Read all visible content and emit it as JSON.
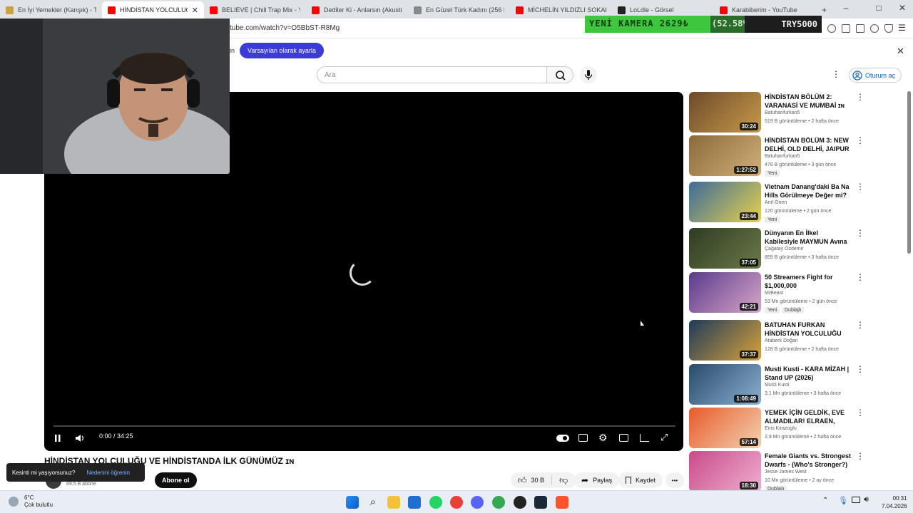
{
  "tabs": [
    {
      "label": "En İyi Yemekler (Karışık) - Tier L",
      "favicon": "#c8a046"
    },
    {
      "label": "HİNDİSTAN YOLCULUĞU V",
      "favicon": "#ff0000",
      "active": true
    },
    {
      "label": "BELIEVE | Chill Trap Mix - YouTu",
      "favicon": "#ff0000"
    },
    {
      "label": "Dediler Ki - Anlarsın (Akustik V",
      "favicon": "#ff0000"
    },
    {
      "label": "En Güzel Türk Kadını (256 Kişi)",
      "favicon": "#888888"
    },
    {
      "label": "MİCHELİN YILDIZLI SOKAK LEZ",
      "favicon": "#ff0000"
    },
    {
      "label": "LoLdle - Görsel",
      "favicon": "#222222"
    },
    {
      "label": "Karabiberim - YouTube",
      "favicon": "#ff0000"
    }
  ],
  "new_tab_icon": "plus-icon",
  "window_controls": {
    "minimize": "–",
    "maximize": "□",
    "close": "✕"
  },
  "url": "tube.com/watch?v=O5BbST-R8Mg",
  "stream_overlay": {
    "left": "YENİ KAMERA  2629₺",
    "middle": "(52.58%)",
    "right": "TRY5000"
  },
  "consent": {
    "left_text": "in",
    "button": "Varsayılan olarak ayarla"
  },
  "search": {
    "placeholder": "Ara"
  },
  "signin": "Oturum aç",
  "player": {
    "time": "0:00 / 34:25"
  },
  "video": {
    "title": "HİNDİSTAN YOLCULUĞU VE HİNDİSTANDA İLK GÜNÜMÜZ ɪɴ",
    "subscribers": "69,5 B abone",
    "subscribe": "Abone ol",
    "likes": "30 B",
    "share": "Paylaş",
    "save": "Kaydet",
    "more": "•••"
  },
  "toast": {
    "text": "Kesinti mi yaşıyorsunuz?",
    "link": "Nedenini öğrenin"
  },
  "recommendations": [
    {
      "title": "HİNDİSTAN BÖLÜM 2: VARANASİ VE MUMBAİ ɪɴ",
      "channel": "Batuhanfurkan5",
      "stats": "519 B görüntüleme • 2 hafta önce",
      "duration": "30:24",
      "colors": [
        "#6b4a2a",
        "#c99a4a"
      ],
      "badges": []
    },
    {
      "title": "HİNDİSTAN BÖLÜM 3: NEW DELHİ, OLD DELHİ, JAIPUR ɪɴ",
      "channel": "Batuhanfurkan5",
      "stats": "478 B görüntüleme • 3 gün önce",
      "duration": "1:27:52",
      "colors": [
        "#8a6a3a",
        "#d3b07a"
      ],
      "badges": [
        "Yeni"
      ]
    },
    {
      "title": "Vietnam Danang'daki Ba Na Hills Görülmeye Değer mi?ᵛᴺ",
      "channel": "Anıl Önen",
      "stats": "120 görüntüleme • 2 gün önce",
      "duration": "23:44",
      "colors": [
        "#3c6b9a",
        "#e8d24a"
      ],
      "badges": [
        "Yeni"
      ]
    },
    {
      "title": "Dünyanın En İlkel Kabilesiyle MAYMUN Avına Çıktık! (3 ...",
      "channel": "Çağatay Özdemir",
      "stats": "859 B görüntüleme • 3 hafta önce",
      "duration": "37:05",
      "colors": [
        "#2f3b22",
        "#6b7a4a"
      ],
      "badges": []
    },
    {
      "title": "50 Streamers Fight for $1,000,000",
      "channel": "MrBeast",
      "stats": "53 Mn görüntüleme • 2 gün önce",
      "duration": "42:21",
      "colors": [
        "#5a3a8a",
        "#d8a6c8"
      ],
      "badges": [
        "Yeni",
        "Dublajlı"
      ]
    },
    {
      "title": "BATUHAN FURKAN HİNDİSTAN YOLCULUĞU VE HİNDİSTAND...",
      "channel": "Ataberk Doğan",
      "stats": "128 B görüntüleme • 2 hafta önce",
      "duration": "37:37",
      "colors": [
        "#1d3a5a",
        "#d9a23a"
      ],
      "badges": []
    },
    {
      "title": "Musti Kusti - KARA MİZAH | Stand UP (2026)",
      "channel": "Musti Kusti",
      "stats": "3,1 Mn görüntüleme • 3 hafta önce",
      "duration": "1:08:49",
      "colors": [
        "#2a4a6a",
        "#8ab0d0"
      ],
      "badges": []
    },
    {
      "title": "YEMEK İÇİN GELDİK, EVE ALMADILAR! ELRAEN, ERAY, ...",
      "channel": "Enis Kirazoglu",
      "stats": "2,9 Mn görüntüleme • 2 hafta önce",
      "duration": "57:14",
      "colors": [
        "#e85a2a",
        "#f2d2b2"
      ],
      "badges": []
    },
    {
      "title": "Female Giants vs. Strongest Dwarfs - (Who's Stronger?)",
      "channel": "Jesse James West",
      "stats": "10 Mn görüntüleme • 2 ay önce",
      "duration": "18:30",
      "colors": [
        "#c84a8a",
        "#f0b0d0"
      ],
      "badges": [
        "Dublajlı"
      ]
    }
  ],
  "taskbar": {
    "weather_temp": "6°C",
    "weather_desc": "Çok bulutlu",
    "time": "00:31",
    "date": "7.04.2026"
  }
}
